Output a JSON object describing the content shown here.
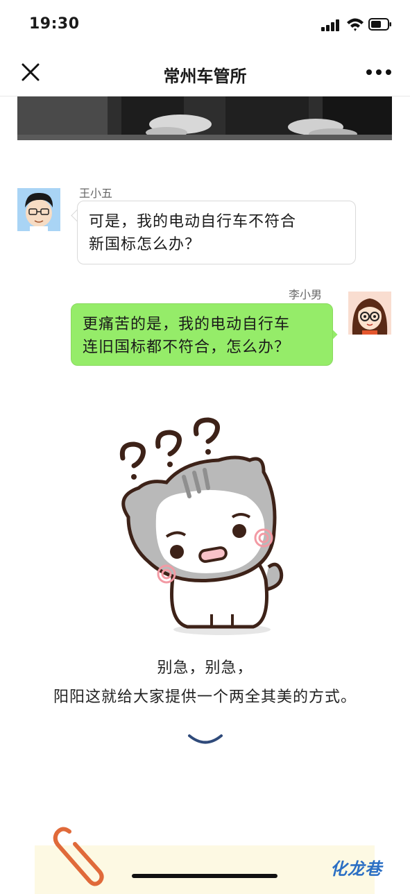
{
  "status_bar": {
    "time": "19:30"
  },
  "nav": {
    "title": "常州车管所",
    "close_icon": "close-icon",
    "more_icon": "more-icon"
  },
  "messages": [
    {
      "sender": "王小五",
      "side": "left",
      "text_lines": [
        "可是，我的电动自行车不符合",
        "新国标怎么办？"
      ]
    },
    {
      "sender": "李小男",
      "side": "right",
      "text_lines": [
        "更痛苦的是，我的电动自行车",
        "连旧国标都不符合，怎么办？"
      ]
    }
  ],
  "caption": {
    "line1": "别急，别急，",
    "line2": "阳阳这就给大家提供一个两全其美的方式。"
  },
  "watermark": "化龙巷",
  "colors": {
    "bubble_right": "#95ec69",
    "bubble_left": "#ffffff",
    "watermark": "#2b6fc4",
    "note_card": "#fdf9e3"
  }
}
